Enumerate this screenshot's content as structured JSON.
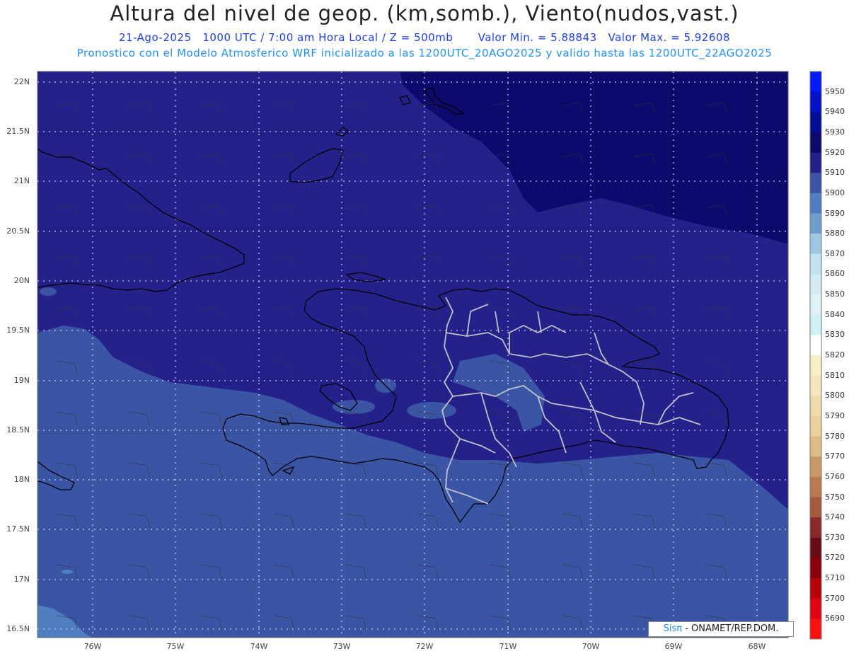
{
  "header": {
    "title": "Altura del nivel de geop. (km,somb.), Viento(nudos,vast.)",
    "date": "21-Ago-2025",
    "time_info": "1000 UTC / 7:00 am Hora Local / Z = 500mb",
    "min_value": "Valor Min. = 5.88843",
    "max_value": "Valor Max. = 5.92608",
    "model_info": "Pronostico con el Modelo Atmosferico WRF inicializado a las 1200UTC_20AGO2025 y valido hasta las  1200UTC_22AGO2025"
  },
  "axes": {
    "lat_labels": [
      "22N",
      "21.5N",
      "21N",
      "20.5N",
      "20N",
      "19.5N",
      "19N",
      "18.5N",
      "18N",
      "17.5N",
      "17N",
      "16.5N"
    ],
    "lon_labels": [
      "76W",
      "75W",
      "74W",
      "73W",
      "72W",
      "71W",
      "70W",
      "69W",
      "68W"
    ]
  },
  "colorbar": {
    "labels": [
      "5950",
      "5940",
      "5930",
      "5920",
      "5910",
      "5900",
      "5890",
      "5880",
      "5870",
      "5860",
      "5850",
      "5840",
      "5830",
      "5820",
      "5810",
      "5800",
      "5790",
      "5780",
      "5770",
      "5760",
      "5750",
      "5740",
      "5730",
      "5720",
      "5710",
      "5700",
      "5690"
    ],
    "colors": [
      "#0019ff",
      "#0012c8",
      "#000e96",
      "#0d0a6e",
      "#25218a",
      "#3a55a4",
      "#4f7fc0",
      "#6d9ece",
      "#9cc8e4",
      "#bfe3ef",
      "#d2ecf4",
      "#e0f2f8",
      "#ccf2f6",
      "#ffffff",
      "#f7efc8",
      "#f4e7bb",
      "#f0dcaa",
      "#ead09a",
      "#dfbc86",
      "#c99867",
      "#b97a50",
      "#a55a3e",
      "#8b2a2a",
      "#6a0c14",
      "#8a0008",
      "#b80008",
      "#e00010",
      "#ff1010"
    ]
  },
  "map": {
    "shading_colors": {
      "dark": "#0d0a6e",
      "mid": "#25218a",
      "light": "#3a55a4",
      "lighter": "#4f7fc0"
    }
  },
  "credit": {
    "brand": "Sisπ",
    "org": " - ONAMET/REP.DOM."
  }
}
